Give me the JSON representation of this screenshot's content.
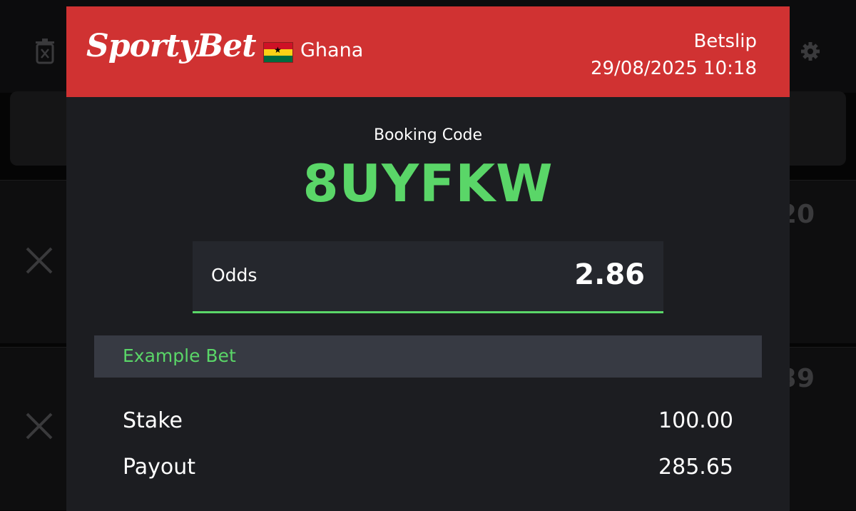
{
  "header": {
    "brand": "SportyBet",
    "country": "Ghana",
    "title": "Betslip",
    "datetime": "29/08/2025 10:18"
  },
  "booking": {
    "label": "Booking Code",
    "code": "8UYFKW"
  },
  "odds": {
    "label": "Odds",
    "value": "2.86"
  },
  "example": {
    "label": "Example Bet",
    "stake_label": "Stake",
    "stake_value": "100.00",
    "payout_label": "Payout",
    "payout_value": "285.65"
  },
  "background": {
    "row_values": [
      "20",
      "39"
    ]
  },
  "icons": {
    "trash": "trash-icon",
    "settings": "gear-icon",
    "remove": "close-icon",
    "flag": "ghana-flag-icon"
  },
  "colors": {
    "brand_red": "#d03232",
    "accent_green": "#5ad668",
    "card_bg": "#1c1d21"
  }
}
